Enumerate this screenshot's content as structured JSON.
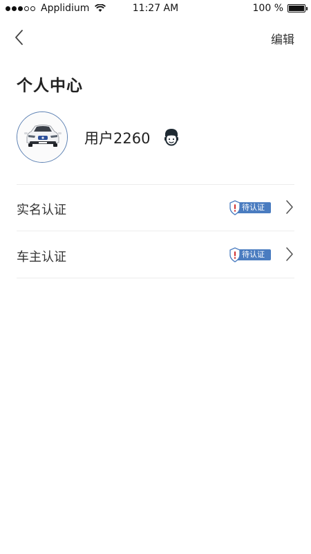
{
  "status_bar": {
    "carrier": "Applidium",
    "time": "11:27 AM",
    "battery": "100 %",
    "battery_level": 1.0
  },
  "nav": {
    "edit_label": "编辑"
  },
  "page": {
    "title": "个人中心"
  },
  "profile": {
    "username": "用户2260"
  },
  "list": [
    {
      "label": "实名认证",
      "badge": "待认证"
    },
    {
      "label": "车主认证",
      "badge": "待认证"
    }
  ],
  "colors": {
    "accent": "#4a7cc0",
    "avatar_border": "#5a7fb2",
    "alert": "#d0302f"
  }
}
